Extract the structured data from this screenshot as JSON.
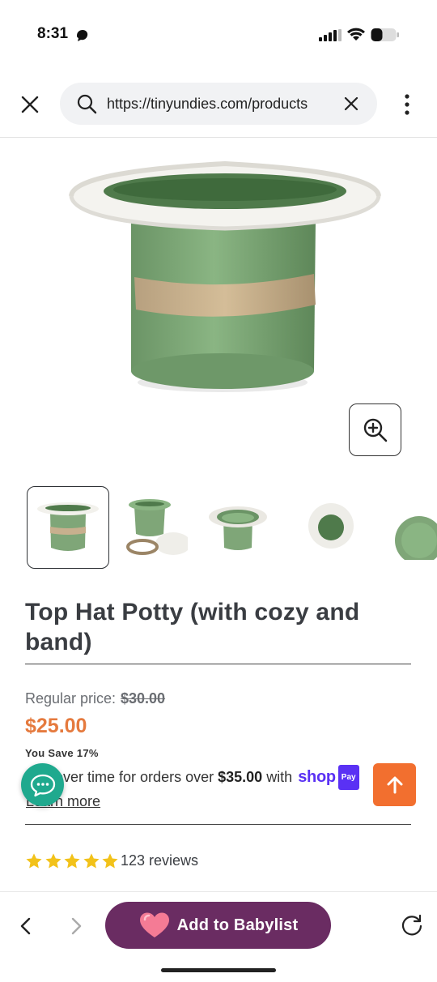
{
  "status_bar": {
    "time": "8:31"
  },
  "browser": {
    "url": "https://tinyundies.com/products",
    "icons": {
      "close": "close-icon",
      "search": "search-icon",
      "clear": "clear-icon",
      "menu": "more-vert-icon"
    }
  },
  "product": {
    "title": "Top Hat Potty (with cozy and band)",
    "thumbnail_count": 5,
    "pricing": {
      "regular_label": "Regular price:",
      "regular_price": "$30.00",
      "sale_price": "$25.00",
      "you_save": "You Save 17%",
      "installments_prefix": "Pay over time for orders over",
      "installments_amount": "$35.00",
      "installments_with": "with",
      "shop_logo_text": "shop",
      "pay_badge_text": "Pay",
      "learn_more": "Learn more"
    },
    "rating": {
      "stars": 5,
      "reviews_label": "123 reviews"
    }
  },
  "bottom_bar": {
    "cta_label": "Add to Babylist"
  },
  "colors": {
    "accent_orange": "#e57a3e",
    "scroll_top_orange": "#f26f2f",
    "chat_green": "#1fa98e",
    "babylist_purple": "#6a2c62",
    "shop_pay_purple": "#5a31f4",
    "star_yellow": "#f2c21a",
    "potty_green": "#7fa678"
  }
}
